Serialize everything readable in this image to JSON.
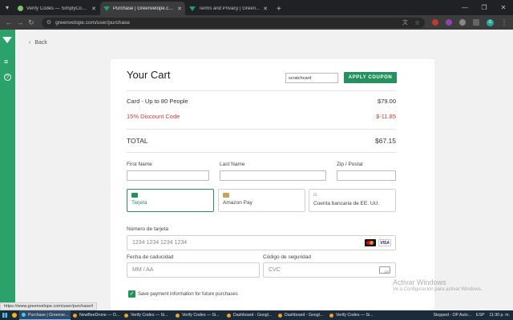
{
  "browser": {
    "tabs": [
      {
        "title": "Verify Codes — SimplyCodes",
        "active": false
      },
      {
        "title": "Purchase | Greenvelope.com",
        "active": true
      },
      {
        "title": "Terms and Privacy | Greenvelope",
        "active": false
      }
    ],
    "url": "greenvelope.com/user/purchase",
    "status_url": "https://www.greenvelope.com/user/purchase#",
    "profile_initial": "G"
  },
  "nav": {
    "back_label": "Back"
  },
  "cart": {
    "title": "Your Cart",
    "coupon_value": "scratchcard",
    "apply_label": "APPLY COUPON",
    "item_label": "Card - Up to 80 People",
    "item_price": "$79.00",
    "discount_label": "15% Discount Code",
    "discount_value": "$-11.85",
    "total_label": "TOTAL",
    "total_value": "$67.15"
  },
  "form": {
    "first_name_label": "First Name",
    "last_name_label": "Last Name",
    "zip_label": "Zip / Postal",
    "payment_methods": [
      {
        "label": "Tarjeta",
        "selected": true
      },
      {
        "label": "Amazon Pay",
        "selected": false
      },
      {
        "label": "Cuenta bancaria de EE. UU.",
        "selected": false
      }
    ],
    "card_number_label": "Número de tarjeta",
    "card_number_placeholder": "1234 1234 1234 1234",
    "card_brands": [
      "mastercard",
      "VISA"
    ],
    "expiry_label": "Fecha de caducidad",
    "expiry_placeholder": "MM / AA",
    "cvc_label": "Código de seguridad",
    "cvc_placeholder": "CVC",
    "cvc_icon_text": "123",
    "save_label": "Save payment information for future purchases",
    "save_checked": true
  },
  "watermark": {
    "line1": "Activar Windows",
    "line2": "Ve a Configuración para activar Windows."
  },
  "taskbar": {
    "items": [
      "Purchase | Greenve...",
      "NewBeeDrone — O...",
      "Verify Codes — Si...",
      "Verify Codes — Si...",
      "Dashboard - Googl...",
      "Dashboard - Googl...",
      "Verify Codes — Si..."
    ],
    "status": "Stopped - OP Auto...",
    "lang": "ESP",
    "time": "11:30 p. m."
  },
  "colors": {
    "brand_green": "#23925f",
    "rail_green": "#2aa26a",
    "discount_red": "#d23b3b"
  }
}
